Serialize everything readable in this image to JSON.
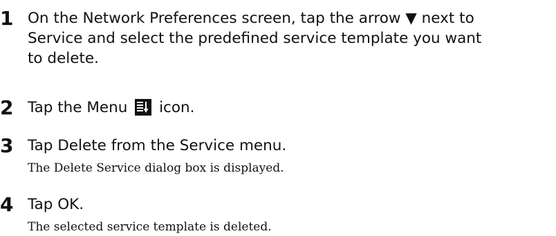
{
  "steps": [
    {
      "number": "1",
      "lines": [
        "On the Network Preferences screen, tap the arrow ▼ next to",
        "Service and select the predefined service template you want",
        "to delete."
      ]
    },
    {
      "number": "2",
      "text_before_icon": "Tap the Menu",
      "icon": "menu-icon",
      "text_after_icon": "icon."
    },
    {
      "number": "3",
      "text": "Tap Delete from the Service menu.",
      "note": "The Delete Service dialog box is displayed."
    },
    {
      "number": "4",
      "text": "Tap OK.",
      "note": "The selected service template is deleted."
    }
  ]
}
